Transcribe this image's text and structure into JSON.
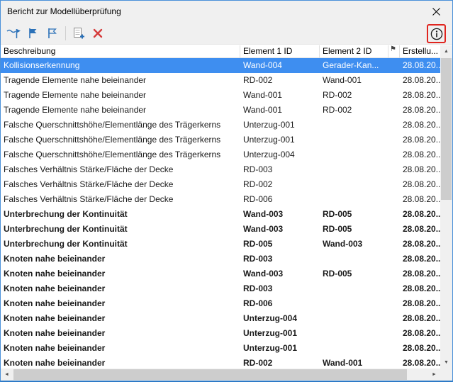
{
  "window": {
    "title": "Bericht zur Modellüberprüfung"
  },
  "icons": {
    "close": "✕",
    "info": "i",
    "flag_header": "⚑",
    "scroll_up": "▲",
    "scroll_down": "▼",
    "scroll_left": "◄",
    "scroll_right": "►"
  },
  "colors": {
    "selection": "#3e8ef0",
    "toolbar_blue": "#2b71b8",
    "delete_red": "#d53c3c",
    "annotation_red": "#e0251f"
  },
  "toolbar": {
    "buttons": [
      {
        "name": "check-navigate"
      },
      {
        "name": "flag-on"
      },
      {
        "name": "flag-off"
      },
      {
        "name": "add-entry"
      },
      {
        "name": "delete"
      },
      {
        "name": "info"
      }
    ]
  },
  "table": {
    "columns": [
      "Beschreibung",
      "Element 1 ID",
      "Element 2 ID",
      "⚑",
      "Erstellu..."
    ],
    "rows": [
      {
        "desc": "Kollisionserkennung",
        "el1": "Wand-004",
        "el2": "Gerader-Kan...",
        "date": "28.08.20...",
        "selected": true,
        "bold": false
      },
      {
        "desc": "Tragende Elemente nahe beieinander",
        "el1": "RD-002",
        "el2": "Wand-001",
        "date": "28.08.20...",
        "selected": false,
        "bold": false
      },
      {
        "desc": "Tragende Elemente nahe beieinander",
        "el1": "Wand-001",
        "el2": "RD-002",
        "date": "28.08.20...",
        "selected": false,
        "bold": false
      },
      {
        "desc": "Tragende Elemente nahe beieinander",
        "el1": "Wand-001",
        "el2": "RD-002",
        "date": "28.08.20...",
        "selected": false,
        "bold": false
      },
      {
        "desc": "Falsche Querschnittshöhe/Elementlänge des Trägerkerns",
        "el1": "Unterzug-001",
        "el2": "",
        "date": "28.08.20...",
        "selected": false,
        "bold": false
      },
      {
        "desc": "Falsche Querschnittshöhe/Elementlänge des Trägerkerns",
        "el1": "Unterzug-001",
        "el2": "",
        "date": "28.08.20...",
        "selected": false,
        "bold": false
      },
      {
        "desc": "Falsche Querschnittshöhe/Elementlänge des Trägerkerns",
        "el1": "Unterzug-004",
        "el2": "",
        "date": "28.08.20...",
        "selected": false,
        "bold": false
      },
      {
        "desc": "Falsches Verhältnis Stärke/Fläche der Decke",
        "el1": "RD-003",
        "el2": "",
        "date": "28.08.20...",
        "selected": false,
        "bold": false
      },
      {
        "desc": "Falsches Verhältnis Stärke/Fläche der Decke",
        "el1": "RD-002",
        "el2": "",
        "date": "28.08.20...",
        "selected": false,
        "bold": false
      },
      {
        "desc": "Falsches Verhältnis Stärke/Fläche der Decke",
        "el1": "RD-006",
        "el2": "",
        "date": "28.08.20...",
        "selected": false,
        "bold": false
      },
      {
        "desc": "Unterbrechung der Kontinuität",
        "el1": "Wand-003",
        "el2": "RD-005",
        "date": "28.08.20...",
        "selected": false,
        "bold": true
      },
      {
        "desc": "Unterbrechung der Kontinuität",
        "el1": "Wand-003",
        "el2": "RD-005",
        "date": "28.08.20...",
        "selected": false,
        "bold": true
      },
      {
        "desc": "Unterbrechung der Kontinuität",
        "el1": "RD-005",
        "el2": "Wand-003",
        "date": "28.08.20...",
        "selected": false,
        "bold": true
      },
      {
        "desc": "Knoten nahe beieinander",
        "el1": "RD-003",
        "el2": "",
        "date": "28.08.20...",
        "selected": false,
        "bold": true
      },
      {
        "desc": "Knoten nahe beieinander",
        "el1": "Wand-003",
        "el2": "RD-005",
        "date": "28.08.20...",
        "selected": false,
        "bold": true
      },
      {
        "desc": "Knoten nahe beieinander",
        "el1": "RD-003",
        "el2": "",
        "date": "28.08.20...",
        "selected": false,
        "bold": true
      },
      {
        "desc": "Knoten nahe beieinander",
        "el1": "RD-006",
        "el2": "",
        "date": "28.08.20...",
        "selected": false,
        "bold": true
      },
      {
        "desc": "Knoten nahe beieinander",
        "el1": "Unterzug-004",
        "el2": "",
        "date": "28.08.20...",
        "selected": false,
        "bold": true
      },
      {
        "desc": "Knoten nahe beieinander",
        "el1": "Unterzug-001",
        "el2": "",
        "date": "28.08.20...",
        "selected": false,
        "bold": true
      },
      {
        "desc": "Knoten nahe beieinander",
        "el1": "Unterzug-001",
        "el2": "",
        "date": "28.08.20...",
        "selected": false,
        "bold": true
      },
      {
        "desc": "Knoten nahe beieinander",
        "el1": "RD-002",
        "el2": "Wand-001",
        "date": "28.08.20...",
        "selected": false,
        "bold": true
      }
    ]
  }
}
